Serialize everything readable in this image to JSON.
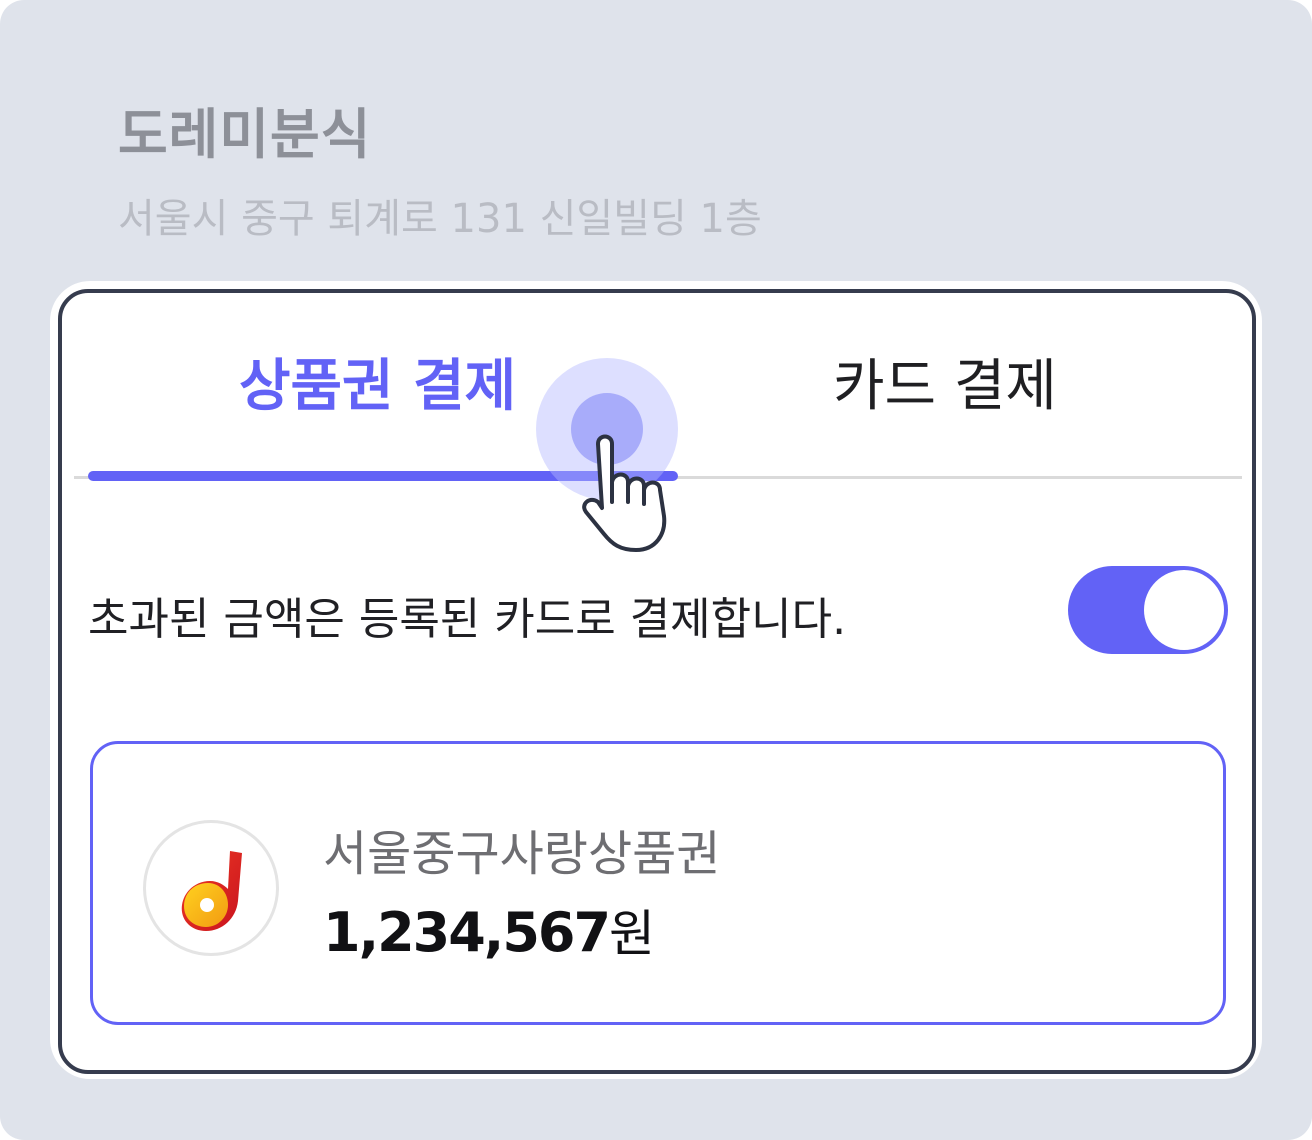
{
  "store": {
    "name": "도레미분식",
    "address": "서울시 중구 퇴계로 131 신일빌딩 1층"
  },
  "payment_tabs": [
    {
      "label": "상품권 결제",
      "selected": true
    },
    {
      "label": "카드 결제",
      "selected": false
    }
  ],
  "excess_payment": {
    "label": "초과된 금액은 등록된 카드로 결제합니다.",
    "toggle_on": true
  },
  "voucher": {
    "name": "서울중구사랑상품권",
    "amount": "1,234,567",
    "unit": "원",
    "logo_icon": "d-logo-icon"
  },
  "colors": {
    "accent": "#6262f6",
    "background": "#dfe3eb",
    "card_border": "#363c4e"
  },
  "pointer": {
    "icon": "hand-pointer-icon"
  }
}
